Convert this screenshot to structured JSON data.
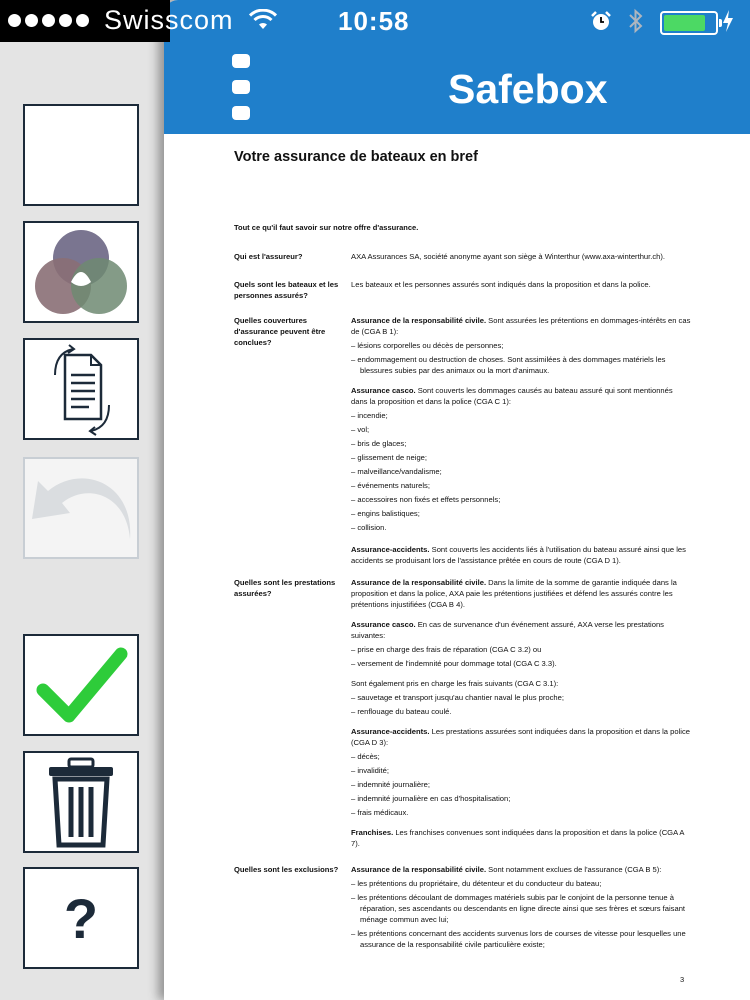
{
  "status_bar": {
    "carrier": "Swisscom",
    "time": "10:58",
    "battery_level": 0.9,
    "icons": [
      "signal-dots-icon",
      "wifi-icon",
      "alarm-icon",
      "bluetooth-icon",
      "battery-icon",
      "charging-icon"
    ]
  },
  "toolbar": {
    "buttons": [
      "color-mode-button",
      "grayscale-mode-button",
      "rotate-page-button",
      "undo-button",
      "confirm-button",
      "delete-button",
      "help-button"
    ],
    "undo_enabled": false,
    "help_label": "?"
  },
  "header": {
    "title": "Safebox",
    "bg_color": "#1f7fcb"
  },
  "document": {
    "title": "Votre assurance de bateaux en bref",
    "intro": "Tout ce qu'il faut savoir sur notre offre d'assurance.",
    "page_number": "3",
    "sections": [
      {
        "question": "Qui est l'assureur?",
        "answer_lines": [
          "AXA Assurances SA, société anonyme ayant son siège à Winterthur (www.axa-winterthur.ch)."
        ]
      },
      {
        "question": "Quels sont les bateaux et les personnes assurés?",
        "answer_lines": [
          "Les bateaux et les personnes assurés sont indiqués dans la proposition et dans la police."
        ]
      },
      {
        "question": "Quelles couvertures d'assurance peuvent être conclues?",
        "b1_bold": "Assurance de la responsabilité civile.",
        "b1_text": " Sont assurées les prétentions en dommages-intérêts en cas de (CGA B 1):",
        "b1_items": [
          "lésions corporelles ou décès de personnes;",
          "endommagement ou destruction de choses. Sont assimilées à des dommages matériels les blessures subies par des animaux ou la mort d'animaux."
        ],
        "b2_bold": "Assurance casco.",
        "b2_text": " Sont couverts les dommages causés au bateau assuré qui sont mentionnés dans la proposition et dans la police (CGA C 1):",
        "b2_items": [
          "incendie;",
          "vol;",
          "bris de glaces;",
          "glissement de neige;",
          "malveillance/vandalisme;",
          "événements naturels;",
          "accessoires non fixés et effets personnels;",
          "engins balistiques;",
          "collision."
        ],
        "b3_bold": "Assurance-accidents.",
        "b3_text": " Sont couverts les accidents liés à l'utilisation du bateau assuré ainsi que les accidents se produisant lors de l'assistance prêtée en cours de route (CGA D 1)."
      },
      {
        "question": "Quelles sont les prestations assurées?",
        "b1_bold": "Assurance de la responsabilité civile.",
        "b1_text": " Dans la limite de la somme de garantie indiquée dans la proposition et dans la police, AXA paie les prétentions justifiées et défend les assurés contre les prétentions injustifiées (CGA B 4).",
        "b2_bold": "Assurance casco.",
        "b2_text": " En cas de survenance d'un événement assuré, AXA verse les prestations suivantes:",
        "b2_items": [
          "prise en charge des frais de réparation (CGA C 3.2) ou",
          "versement de l'indemnité pour dommage total (CGA C 3.3)."
        ],
        "b2b_text": "Sont également pris en charge les frais suivants (CGA C 3.1):",
        "b2b_items": [
          "sauvetage et transport jusqu'au chantier naval le plus proche;",
          "renflouage du bateau coulé."
        ],
        "b3_bold": "Assurance-accidents.",
        "b3_text": " Les prestations assurées sont indiquées dans la proposition et dans la police (CGA D 3):",
        "b3_items": [
          "décès;",
          "invalidité;",
          "indemnité journalière;",
          "indemnité journalière en cas d'hospitalisation;",
          "frais médicaux."
        ],
        "b4_bold": "Franchises.",
        "b4_text": " Les franchises convenues sont indiquées dans la proposition et dans la police (CGA A 7)."
      },
      {
        "question": "Quelles sont les exclusions?",
        "b1_bold": "Assurance de la responsabilité civile.",
        "b1_text": " Sont notamment exclues de l'assurance (CGA B 5):",
        "b1_items": [
          "les prétentions du propriétaire, du détenteur et du conducteur du bateau;",
          "les prétentions découlant de dommages matériels subis par le conjoint de la personne tenue à réparation, ses ascendants ou descendants en ligne directe ainsi que ses frères et sœurs faisant ménage commun avec lui;",
          "les prétentions concernant des accidents survenus lors de courses de vitesse pour lesquelles une assurance de la responsabilité civile particulière existe;"
        ]
      }
    ]
  }
}
